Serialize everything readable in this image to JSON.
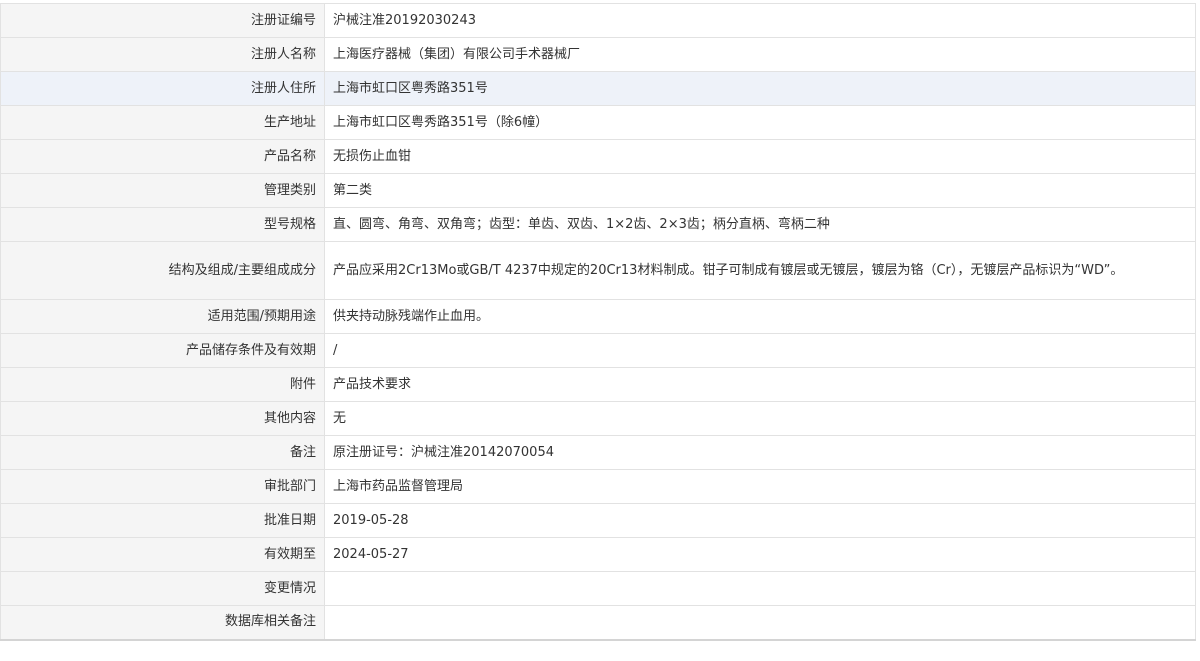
{
  "rows": [
    {
      "label": "注册证编号",
      "value": "沪械注准20192030243"
    },
    {
      "label": "注册人名称",
      "value": "上海医疗器械（集团）有限公司手术器械厂"
    },
    {
      "label": "注册人住所",
      "value": "上海市虹口区粤秀路351号"
    },
    {
      "label": "生产地址",
      "value": "上海市虹口区粤秀路351号（除6幢）"
    },
    {
      "label": "产品名称",
      "value": "无损伤止血钳"
    },
    {
      "label": "管理类别",
      "value": "第二类"
    },
    {
      "label": "型号规格",
      "value": "直、圆弯、角弯、双角弯；齿型：单齿、双齿、1×2齿、2×3齿；柄分直柄、弯柄二种"
    },
    {
      "label": "结构及组成/主要组成成分",
      "value": "产品应采用2Cr13Mo或GB/T 4237中规定的20Cr13材料制成。钳子可制成有镀层或无镀层，镀层为铬（Cr），无镀层产品标识为“WD”。"
    },
    {
      "label": "适用范围/预期用途",
      "value": "供夹持动脉残端作止血用。"
    },
    {
      "label": "产品储存条件及有效期",
      "value": "/"
    },
    {
      "label": "附件",
      "value": "产品技术要求"
    },
    {
      "label": "其他内容",
      "value": "无"
    },
    {
      "label": "备注",
      "value": "原注册证号：沪械注准20142070054"
    },
    {
      "label": "审批部门",
      "value": "上海市药品监督管理局"
    },
    {
      "label": "批准日期",
      "value": "2019-05-28"
    },
    {
      "label": "有效期至",
      "value": "2024-05-27"
    },
    {
      "label": "变更情况",
      "value": ""
    },
    {
      "label": "数据库相关备注",
      "value": ""
    }
  ],
  "colors": {
    "label_background": "#f5f5f5",
    "highlight_background": "#eef2f9",
    "border": "#e2e2e2",
    "text": "#333333"
  }
}
